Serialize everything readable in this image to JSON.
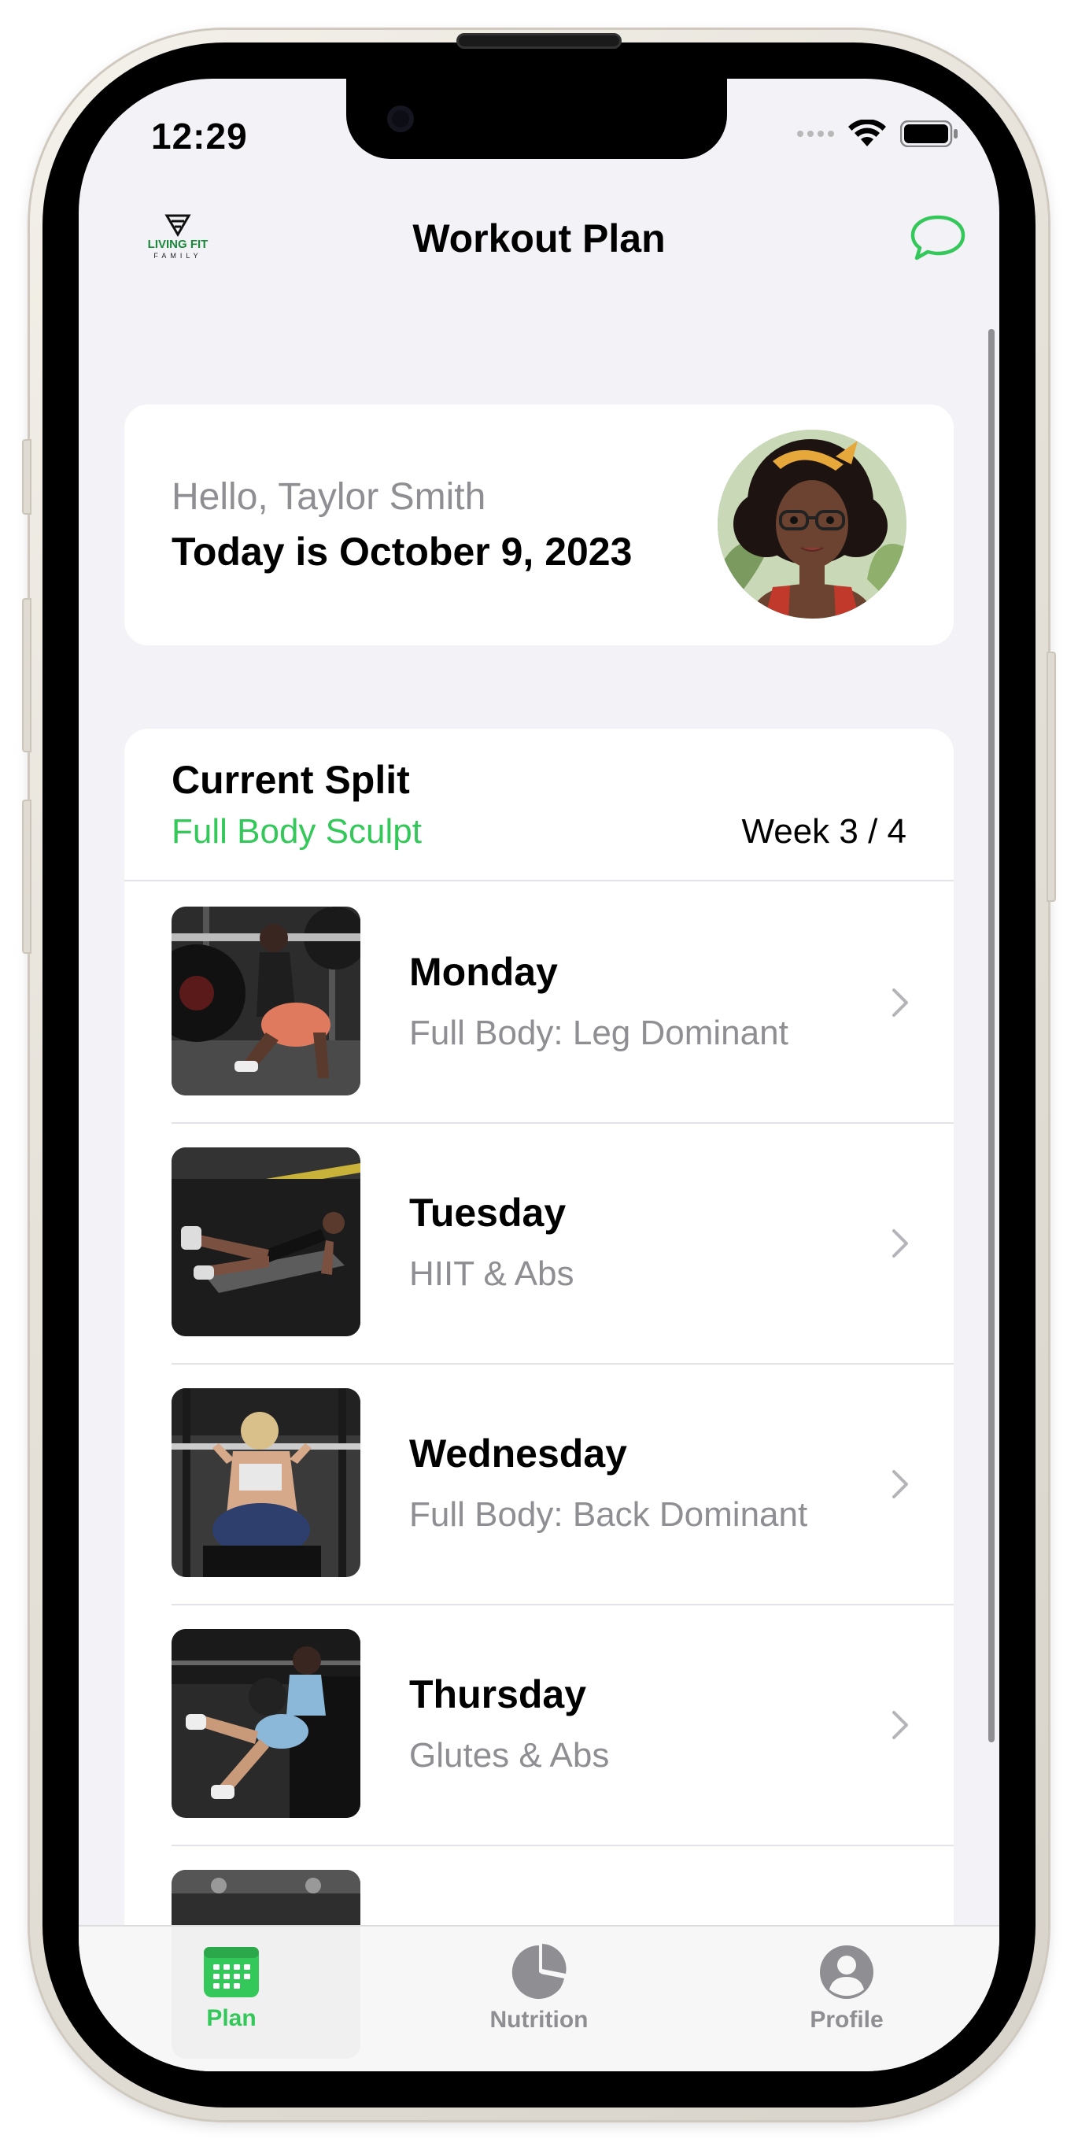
{
  "status_bar": {
    "time": "12:29"
  },
  "nav": {
    "title": "Workout Plan",
    "logo_text": "LIVING FIT",
    "logo_subtext": "FAMILY"
  },
  "greeting": {
    "hello": "Hello, Taylor Smith",
    "date": "Today is October 9, 2023"
  },
  "split": {
    "title": "Current Split",
    "name": "Full Body Sculpt",
    "week": "Week 3 / 4",
    "days": [
      {
        "name": "Monday",
        "desc": "Full Body: Leg Dominant"
      },
      {
        "name": "Tuesday",
        "desc": "HIIT & Abs"
      },
      {
        "name": "Wednesday",
        "desc": "Full Body: Back Dominant"
      },
      {
        "name": "Thursday",
        "desc": "Glutes & Abs"
      }
    ]
  },
  "tabbar": {
    "tabs": [
      {
        "label": "Plan",
        "icon": "calendar-icon",
        "active": true
      },
      {
        "label": "Nutrition",
        "icon": "pie-chart-icon",
        "active": false
      },
      {
        "label": "Profile",
        "icon": "person-circle-icon",
        "active": false
      }
    ]
  },
  "colors": {
    "accent": "#34c759",
    "background": "#f2f2f7",
    "card": "#ffffff",
    "secondary_text": "#8e8e93",
    "inactive_tab": "#8e8e93"
  }
}
